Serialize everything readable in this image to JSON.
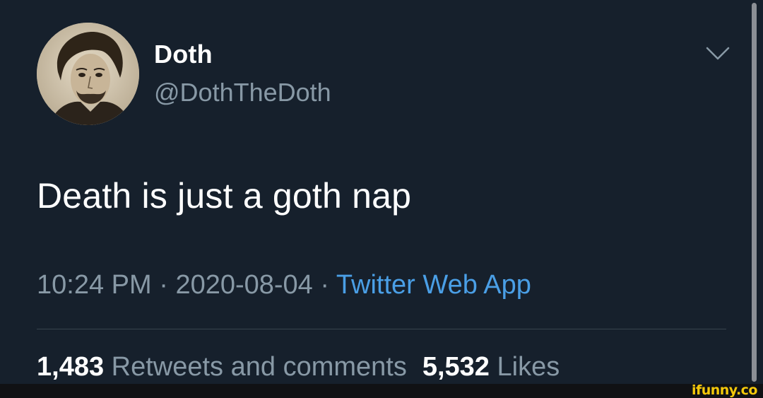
{
  "tweet": {
    "author": {
      "display_name": "Doth",
      "handle": "@DothTheDoth",
      "avatar_icon": "portrait-avatar"
    },
    "menu_icon": "chevron-down-icon",
    "text": "Death is just a goth nap",
    "time": "10:24 PM",
    "separator": "·",
    "date": "2020-08-04",
    "source": "Twitter Web App",
    "stats": {
      "retweets_count": "1,483",
      "retweets_label": "Retweets and comments",
      "likes_count": "5,532",
      "likes_label": "Likes"
    }
  },
  "watermark": "ifunny.co",
  "colors": {
    "background": "#16202c",
    "primary_text": "#ffffff",
    "secondary_text": "#8899a6",
    "link": "#4a9fe6",
    "divider": "#38444d",
    "watermark": "#f4c80a"
  }
}
